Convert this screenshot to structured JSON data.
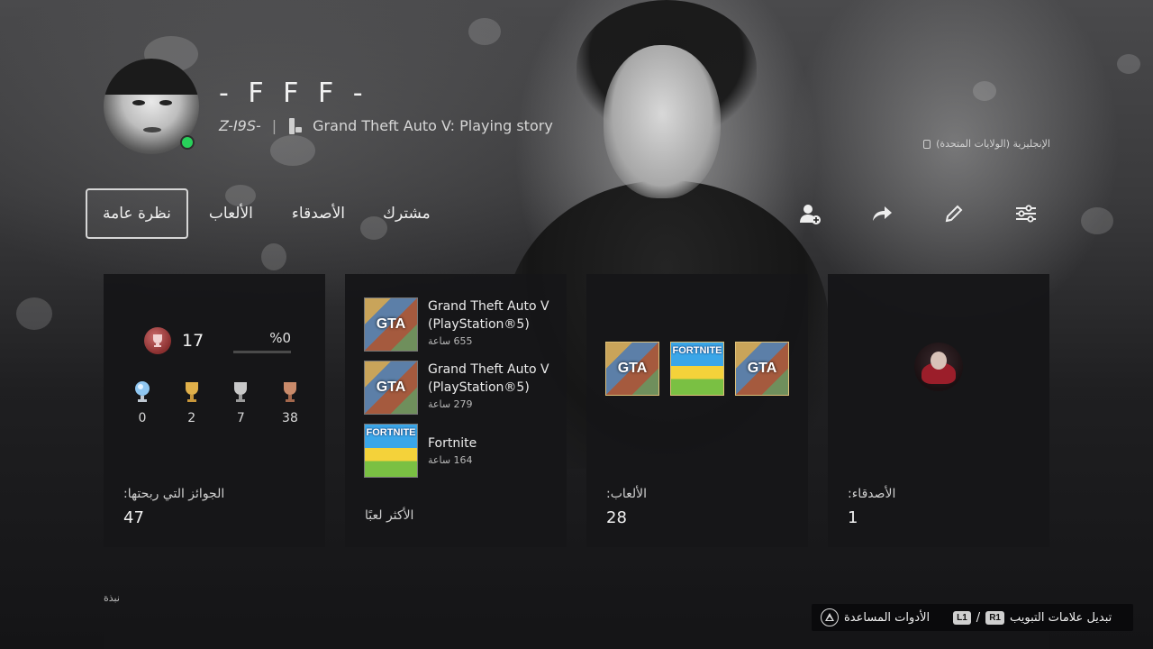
{
  "profile": {
    "username": "- F F F -",
    "online_id": "Z-I9S-",
    "separator": "|",
    "activity": "Grand Theft Auto V: Playing story",
    "language": "الإنجليزية (الولايات المتحدة)",
    "online_status_color": "#28d05a"
  },
  "tabs": [
    {
      "label": "نظرة عامة",
      "active": true
    },
    {
      "label": "الألعاب"
    },
    {
      "label": "الأصدقاء"
    },
    {
      "label": "مشترك"
    }
  ],
  "actions": [
    {
      "icon": "add-friend-icon"
    },
    {
      "icon": "share-icon"
    },
    {
      "icon": "edit-icon"
    },
    {
      "icon": "settings-sliders-icon"
    }
  ],
  "trophies": {
    "level": "17",
    "progress": "%0",
    "progress_fraction": 0,
    "counts": {
      "platinum": "0",
      "gold": "2",
      "silver": "7",
      "bronze": "38"
    },
    "caption": "الجوائز التي ربحتها:",
    "total": "47"
  },
  "most_played": {
    "items": [
      {
        "title": "Grand Theft Auto V (PlayStation®5)",
        "hours": "655 ساعة",
        "cover": "gta"
      },
      {
        "title": "Grand Theft Auto V (PlayStation®5)",
        "hours": "279 ساعة",
        "cover": "gta"
      },
      {
        "title": "Fortnite",
        "hours": "164 ساعة",
        "cover": "fortnite"
      }
    ],
    "caption": "الأكثر لعبًا"
  },
  "games": {
    "covers": [
      "gta",
      "fortnite",
      "gta"
    ],
    "caption": "الألعاب:",
    "count": "28"
  },
  "friends": {
    "caption": "الأصدقاء:",
    "count": "1"
  },
  "bio": {
    "label": "نبذة"
  },
  "help_bar": {
    "switch_tabs": "تبديل علامات التبويب",
    "r1": "R1",
    "slash": "/",
    "l1": "L1",
    "help_tools": "الأدوات المساعدة"
  }
}
